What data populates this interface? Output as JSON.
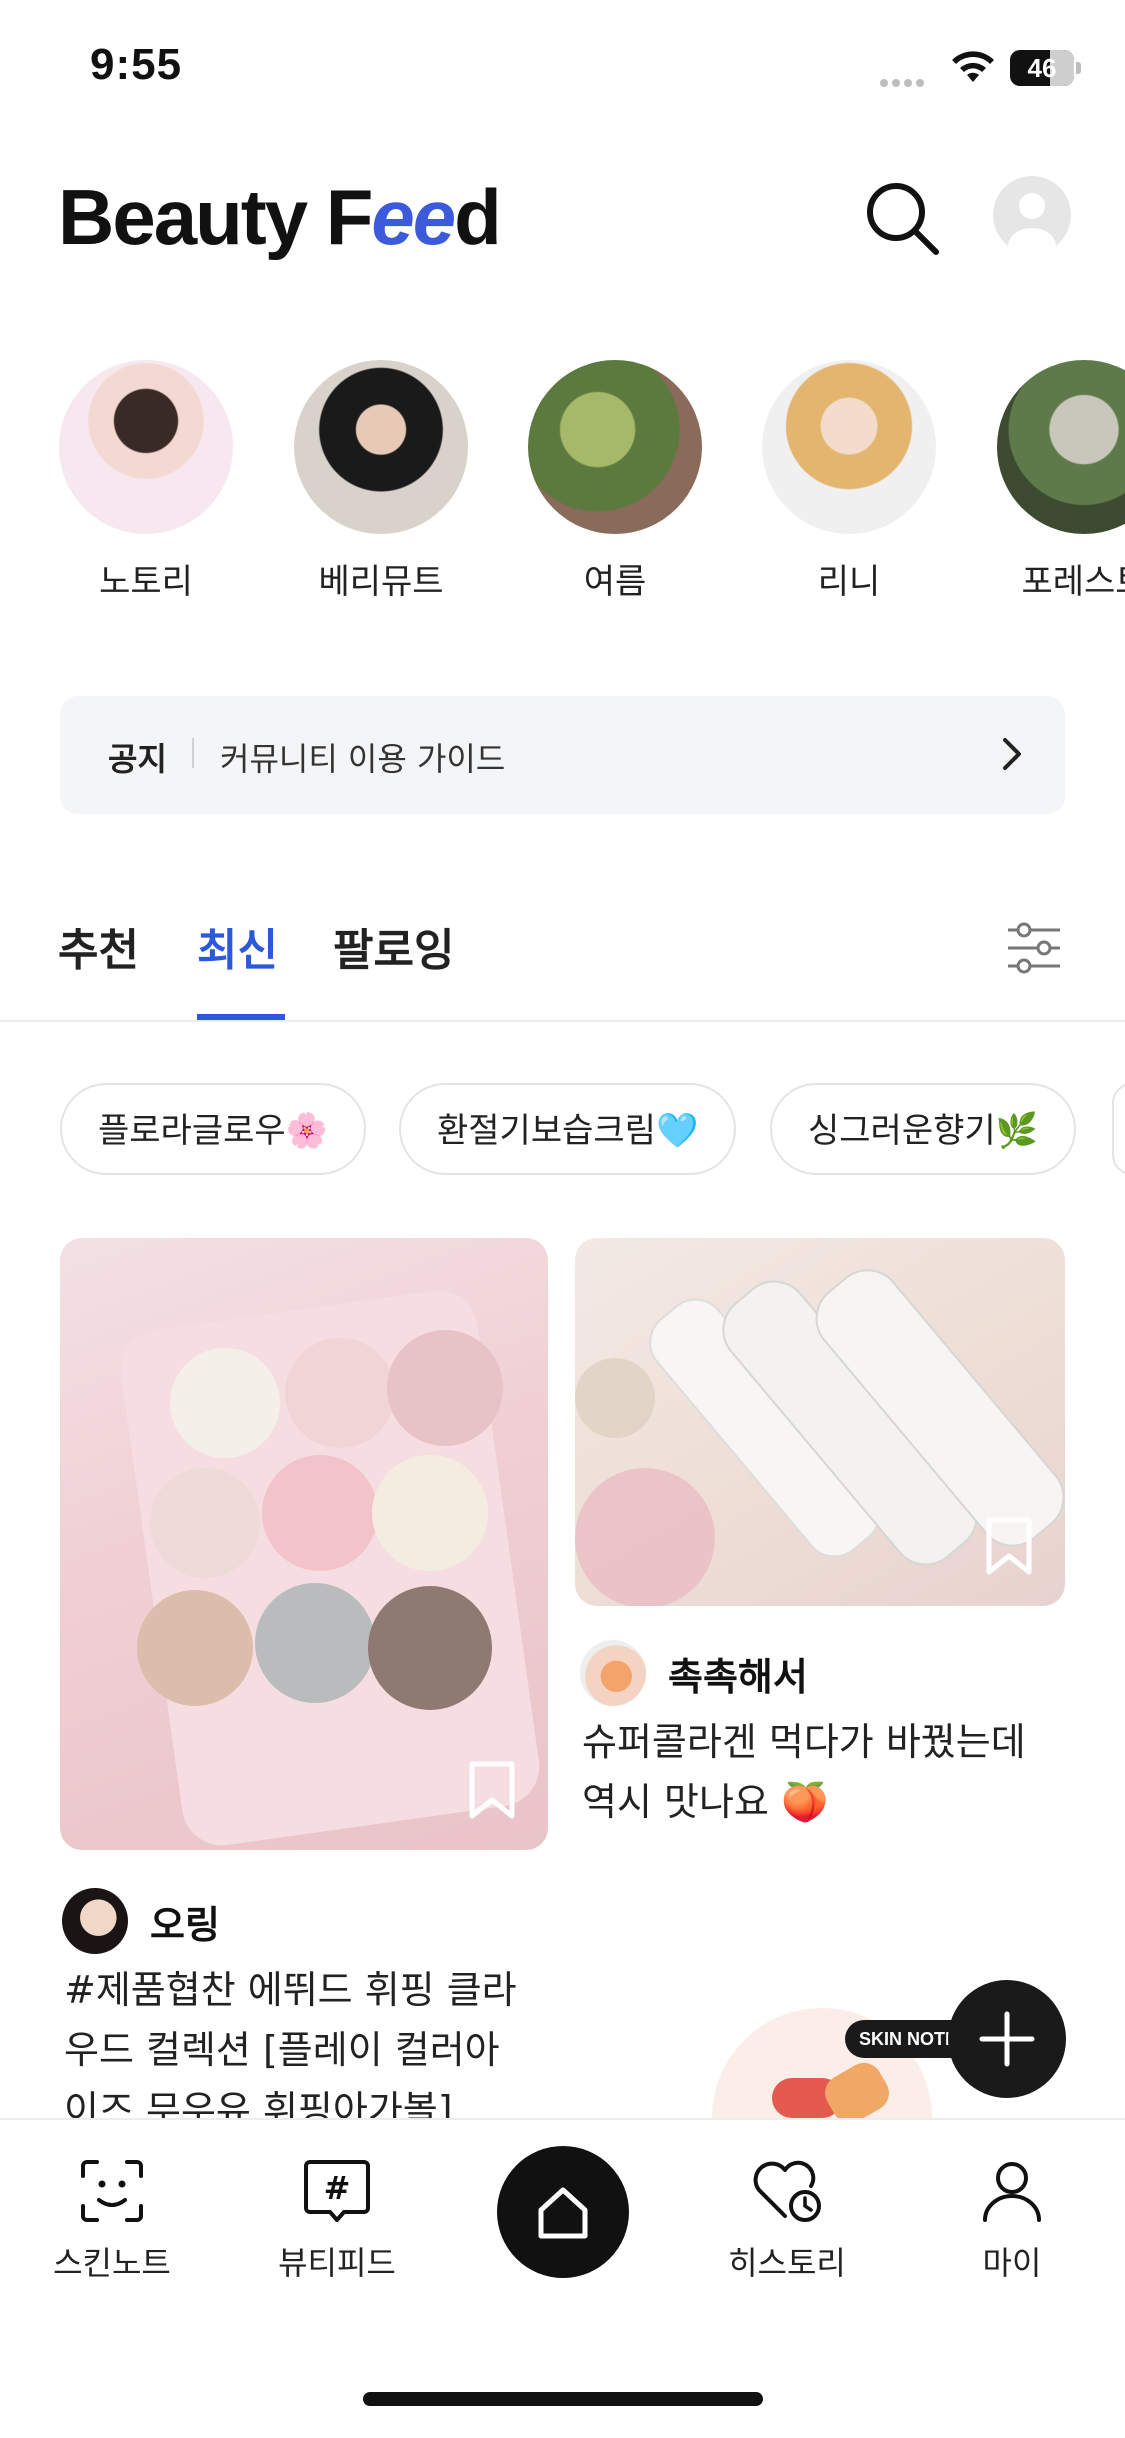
{
  "status_bar": {
    "time": "9:55",
    "battery": "46"
  },
  "header": {
    "logo": "Beauty Feed"
  },
  "stories": [
    {
      "label": "노토리"
    },
    {
      "label": "베리뮤트"
    },
    {
      "label": "여름"
    },
    {
      "label": "리니"
    },
    {
      "label": "포레스트"
    }
  ],
  "notice": {
    "tag": "공지",
    "text": "커뮤니티 이용 가이드"
  },
  "tabs": [
    {
      "label": "추천",
      "active": false
    },
    {
      "label": "최신",
      "active": true
    },
    {
      "label": "팔로잉",
      "active": false
    }
  ],
  "chips": [
    {
      "label": "플로라글로우🌸"
    },
    {
      "label": "환절기보습크림🩵"
    },
    {
      "label": "싱그러운향기🌿"
    }
  ],
  "cards": [
    {
      "author": "오링",
      "text_line1": "#제품협찬 에뛰드 휘핑 클라",
      "text_line2": "우드 컬렉션 [플레이 컬러아",
      "text_line3": "이즈 무우유 휘핑아가볼] ..."
    },
    {
      "author": "촉촉해서",
      "text_line1": "슈퍼콜라겐 먹다가 바꿨는데",
      "text_line2": "역시 맛나요 🍑"
    }
  ],
  "fab": {
    "badge": "SKIN NOTE"
  },
  "bottom_nav": [
    {
      "label": "스킨노트",
      "icon": "face-scan-icon"
    },
    {
      "label": "뷰티피드",
      "icon": "hashtag-icon"
    },
    {
      "label": "",
      "icon": "home-icon"
    },
    {
      "label": "히스토리",
      "icon": "heart-history-icon"
    },
    {
      "label": "마이",
      "icon": "person-icon"
    }
  ]
}
